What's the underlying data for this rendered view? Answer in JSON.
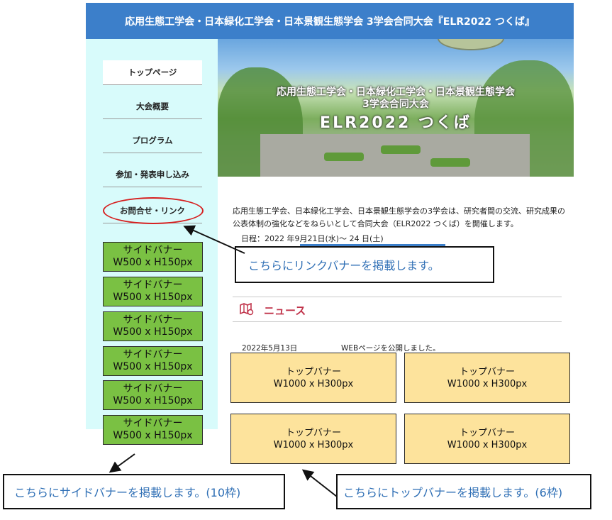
{
  "header": {
    "title": "応用生態工学会・日本緑化工学会・日本景観生態学会 3学会合同大会『ELR2022 つくば』"
  },
  "nav": {
    "items": [
      {
        "label": "トップページ"
      },
      {
        "label": "大会概要"
      },
      {
        "label": "プログラム"
      },
      {
        "label": "参加・発表申し込み"
      },
      {
        "label": "お問合せ・リンク"
      }
    ]
  },
  "side_banners": [
    {
      "line1": "サイドバナー",
      "line2": "W500 x H150px"
    },
    {
      "line1": "サイドバナー",
      "line2": "W500 x H150px"
    },
    {
      "line1": "サイドバナー",
      "line2": "W500 x H150px"
    },
    {
      "line1": "サイドバナー",
      "line2": "W500 x H150px"
    },
    {
      "line1": "サイドバナー",
      "line2": "W500 x H150px"
    },
    {
      "line1": "サイドバナー",
      "line2": "W500 x H150px"
    }
  ],
  "hero": {
    "line1": "応用生態工学会・日本緑化工学会・日本景観生態学会",
    "line2": "3学会合同大会",
    "line3": "ELR2022 つくば"
  },
  "intro": {
    "text": "応用生態工学会、日本緑化工学会、日本景観生態学会の3学会は、研究者間の交流、研究成果の公表体制の強化などをねらいとして合同大会（ELR2022 つくば）を開催します。",
    "date": "日程：2022 年9月21日(水)～ 24 日(土)"
  },
  "callouts": {
    "link_banner": "こちらにリンクバナーを掲載します。",
    "side_banner": "こちらにサイドバナーを掲載します。(10枠)",
    "top_banner": "こちらにトップバナーを掲載します。(6枠)"
  },
  "news": {
    "title": "ニュース",
    "items": [
      {
        "date": "2022年5月13日",
        "text": "WEBページを公開しました。"
      }
    ]
  },
  "top_banners": [
    {
      "line1": "トップバナー",
      "line2": "W1000 x H300px"
    },
    {
      "line1": "トップバナー",
      "line2": "W1000 x H300px"
    },
    {
      "line1": "トップバナー",
      "line2": "W1000 x H300px"
    },
    {
      "line1": "トップバナー",
      "line2": "W1000 x H300px"
    }
  ],
  "colors": {
    "header_bg": "#3c7fca",
    "sidebar_bg": "#d8fbfb",
    "side_banner": "#7ac143",
    "top_banner": "#fde39c",
    "news_accent": "#c0334a",
    "highlight_ellipse": "#d61f1f",
    "callout_text": "#2f6fb5"
  }
}
